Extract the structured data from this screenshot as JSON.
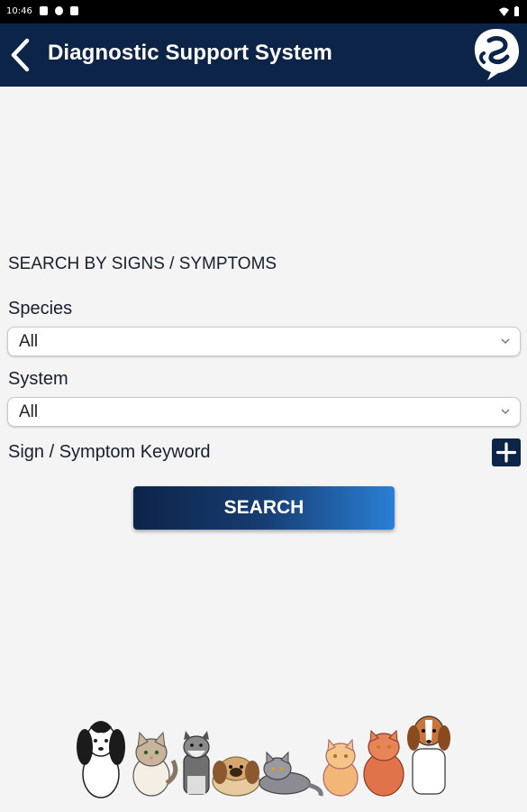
{
  "status_bar": {
    "time": "10:46"
  },
  "app_bar": {
    "title": "Diagnostic Support System"
  },
  "form": {
    "section_title": "SEARCH BY SIGNS / SYMPTOMS",
    "species_label": "Species",
    "species_value": "All",
    "system_label": "System",
    "system_value": "All",
    "keyword_label": "Sign / Symptom Keyword",
    "search_label": "SEARCH"
  },
  "colors": {
    "brand_navy": "#0d2449",
    "button_gradient_end": "#2a7fd6",
    "background": "#f4f4f4"
  },
  "icons": [
    "back-arrow-icon",
    "brand-logo",
    "chevron-down-icon",
    "plus-icon",
    "wifi-icon",
    "battery-icon"
  ]
}
